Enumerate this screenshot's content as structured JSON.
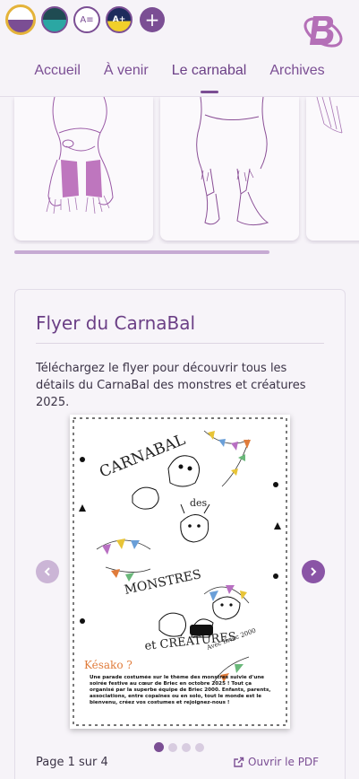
{
  "theme_switcher": {
    "themes": [
      {
        "name": "default-theme",
        "top": "#ffffff",
        "bottom": "#7b4e94"
      },
      {
        "name": "dark-teal-theme",
        "top": "#1f4b52",
        "bottom": "#2ba7a3"
      },
      {
        "name": "font-accessible-theme",
        "label": "A≡"
      },
      {
        "name": "high-contrast-theme",
        "label": "A+"
      }
    ],
    "add_label": "+"
  },
  "nav": {
    "items": [
      "Accueil",
      "À venir",
      "Le carnabal",
      "Archives"
    ],
    "active": "Le carnabal"
  },
  "flyer_section": {
    "title": "Flyer du CarnaBal",
    "description": "Téléchargez le flyer pour découvrir tous les détails du CarnaBal des monstres et créatures 2025.",
    "flyer_text": {
      "headline_1": "CARNABAL",
      "headline_2": "des",
      "headline_3": "MONSTRES",
      "headline_4": "et CRÉATURES",
      "signature": "Avec Briec 2000",
      "kesako": "Késako ?",
      "body": "Une parade costumée sur le thème des monstres suivie d'une soirée festive au cœur de Briec en octobre 2025 ! Tout ça organisé par la superbe équipe de Briec 2000. Enfants, parents, associations, entre copaines ou en solo, tout le monde est le bienvenu, créez vos costumes et rejoignez-nous !"
    },
    "page_info": "Page 1 sur 4",
    "current_page": 1,
    "total_pages": 4,
    "open_pdf_label": "Ouvrir le PDF"
  },
  "colors": {
    "accent": "#7b4e94",
    "background": "#f6f3f8",
    "gallery_scroll_fraction": 0.77
  }
}
